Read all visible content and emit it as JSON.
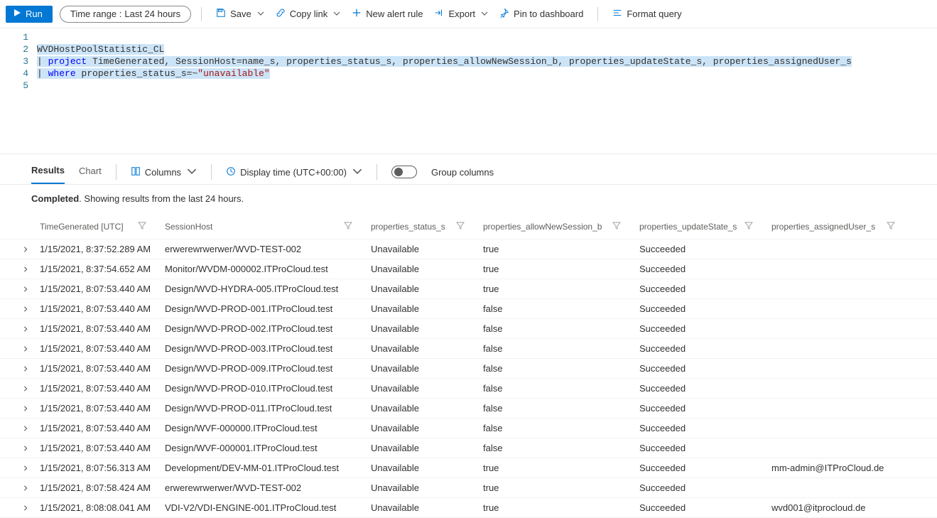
{
  "toolbar": {
    "run": "Run",
    "time_range_label": "Time range : ",
    "time_range_value": "Last 24 hours",
    "save": "Save",
    "copy_link": "Copy link",
    "new_alert": "New alert rule",
    "export": "Export",
    "pin": "Pin to dashboard",
    "format": "Format query"
  },
  "editor": {
    "lines": [
      "1",
      "2",
      "3",
      "4",
      "5"
    ],
    "l1": "WVDHostPoolStatistic_CL",
    "l2a": "project",
    "l2b": " TimeGenerated, SessionHost=name_s, properties_status_s, properties_allowNewSession_b, properties_updateState_s, properties_assignedUser_s",
    "l3a": "where",
    "l3b": " properties_status_s=~",
    "l3c": "\"unavailable\""
  },
  "results_bar": {
    "tab_results": "Results",
    "tab_chart": "Chart",
    "columns": "Columns",
    "display_time": "Display time (UTC+00:00)",
    "group_columns": "Group columns"
  },
  "status": {
    "completed": "Completed",
    "rest": ". Showing results from the last 24 hours."
  },
  "columns": {
    "time": "TimeGenerated [UTC]",
    "host": "SessionHost",
    "status": "properties_status_s",
    "allow": "properties_allowNewSession_b",
    "update": "properties_updateState_s",
    "user": "properties_assignedUser_s"
  },
  "rows": [
    {
      "t": "1/15/2021, 8:37:52.289 AM",
      "h": "erwerewrwerwer/WVD-TEST-002",
      "s": "Unavailable",
      "a": "true",
      "u": "Succeeded",
      "r": ""
    },
    {
      "t": "1/15/2021, 8:37:54.652 AM",
      "h": "Monitor/WVDM-000002.ITProCloud.test",
      "s": "Unavailable",
      "a": "true",
      "u": "Succeeded",
      "r": ""
    },
    {
      "t": "1/15/2021, 8:07:53.440 AM",
      "h": "Design/WVD-HYDRA-005.ITProCloud.test",
      "s": "Unavailable",
      "a": "true",
      "u": "Succeeded",
      "r": ""
    },
    {
      "t": "1/15/2021, 8:07:53.440 AM",
      "h": "Design/WVD-PROD-001.ITProCloud.test",
      "s": "Unavailable",
      "a": "false",
      "u": "Succeeded",
      "r": ""
    },
    {
      "t": "1/15/2021, 8:07:53.440 AM",
      "h": "Design/WVD-PROD-002.ITProCloud.test",
      "s": "Unavailable",
      "a": "false",
      "u": "Succeeded",
      "r": ""
    },
    {
      "t": "1/15/2021, 8:07:53.440 AM",
      "h": "Design/WVD-PROD-003.ITProCloud.test",
      "s": "Unavailable",
      "a": "false",
      "u": "Succeeded",
      "r": ""
    },
    {
      "t": "1/15/2021, 8:07:53.440 AM",
      "h": "Design/WVD-PROD-009.ITProCloud.test",
      "s": "Unavailable",
      "a": "false",
      "u": "Succeeded",
      "r": ""
    },
    {
      "t": "1/15/2021, 8:07:53.440 AM",
      "h": "Design/WVD-PROD-010.ITProCloud.test",
      "s": "Unavailable",
      "a": "false",
      "u": "Succeeded",
      "r": ""
    },
    {
      "t": "1/15/2021, 8:07:53.440 AM",
      "h": "Design/WVD-PROD-011.ITProCloud.test",
      "s": "Unavailable",
      "a": "false",
      "u": "Succeeded",
      "r": ""
    },
    {
      "t": "1/15/2021, 8:07:53.440 AM",
      "h": "Design/WVF-000000.ITProCloud.test",
      "s": "Unavailable",
      "a": "false",
      "u": "Succeeded",
      "r": ""
    },
    {
      "t": "1/15/2021, 8:07:53.440 AM",
      "h": "Design/WVF-000001.ITProCloud.test",
      "s": "Unavailable",
      "a": "false",
      "u": "Succeeded",
      "r": ""
    },
    {
      "t": "1/15/2021, 8:07:56.313 AM",
      "h": "Development/DEV-MM-01.ITProCloud.test",
      "s": "Unavailable",
      "a": "true",
      "u": "Succeeded",
      "r": "mm-admin@ITProCloud.de"
    },
    {
      "t": "1/15/2021, 8:07:58.424 AM",
      "h": "erwerewrwerwer/WVD-TEST-002",
      "s": "Unavailable",
      "a": "true",
      "u": "Succeeded",
      "r": ""
    },
    {
      "t": "1/15/2021, 8:08:08.041 AM",
      "h": "VDI-V2/VDI-ENGINE-001.ITProCloud.test",
      "s": "Unavailable",
      "a": "true",
      "u": "Succeeded",
      "r": "wvd001@itprocloud.de"
    }
  ]
}
